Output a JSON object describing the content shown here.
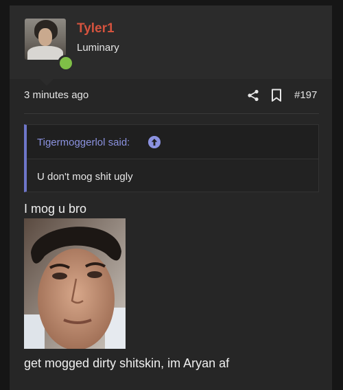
{
  "post": {
    "user": {
      "name": "Tyler1",
      "title": "Luminary",
      "name_color": "#d5533e",
      "online_status_color": "#7fbf47"
    },
    "meta": {
      "time": "3 minutes ago",
      "share_icon": "share-icon",
      "bookmark_icon": "bookmark-icon",
      "post_number": "#197"
    },
    "quote": {
      "author_label": "Tigermoggerlol said:",
      "body": "U don't mog shit ugly",
      "accent_color": "#6e76c9",
      "jump_icon": "arrow-up-circle-icon"
    },
    "messages": [
      "I mog u bro",
      "get mogged dirty shitskin, im Aryan af"
    ]
  }
}
